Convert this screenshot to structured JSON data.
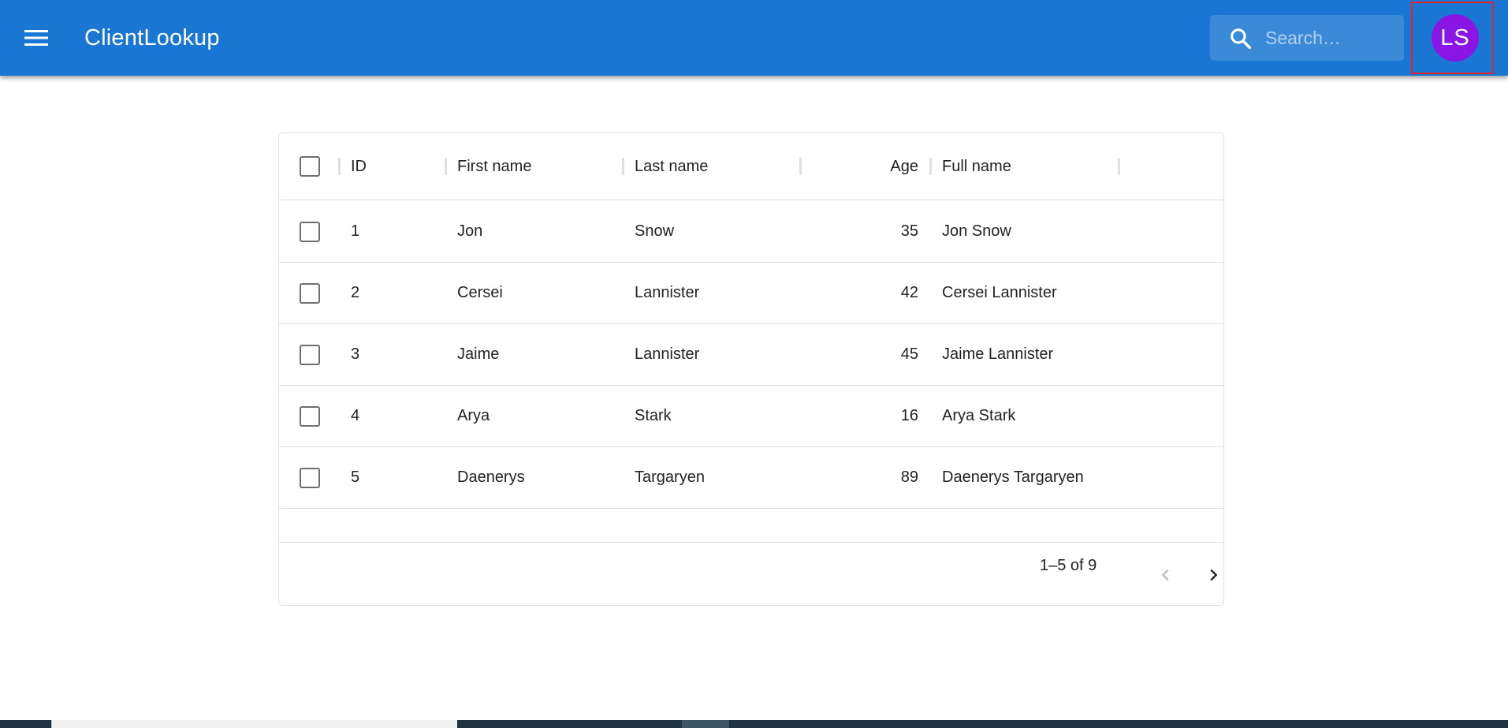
{
  "app": {
    "title": "ClientLookup",
    "search_placeholder": "Search…",
    "avatar_initials": "LS",
    "avatar_color": "#8a16e6",
    "appbar_color": "#1976d2"
  },
  "grid": {
    "columns": {
      "id": "ID",
      "first_name": "First name",
      "last_name": "Last name",
      "age": "Age",
      "full_name": "Full name"
    },
    "rows": [
      {
        "id": "1",
        "first_name": "Jon",
        "last_name": "Snow",
        "age": "35",
        "full_name": "Jon Snow"
      },
      {
        "id": "2",
        "first_name": "Cersei",
        "last_name": "Lannister",
        "age": "42",
        "full_name": "Cersei Lannister"
      },
      {
        "id": "3",
        "first_name": "Jaime",
        "last_name": "Lannister",
        "age": "45",
        "full_name": "Jaime Lannister"
      },
      {
        "id": "4",
        "first_name": "Arya",
        "last_name": "Stark",
        "age": "16",
        "full_name": "Arya Stark"
      },
      {
        "id": "5",
        "first_name": "Daenerys",
        "last_name": "Targaryen",
        "age": "89",
        "full_name": "Daenerys Targaryen"
      }
    ],
    "pagination": {
      "label": "1–5 of 9",
      "prev_icon": "chevron-left-icon",
      "next_icon": "chevron-right-icon"
    }
  }
}
